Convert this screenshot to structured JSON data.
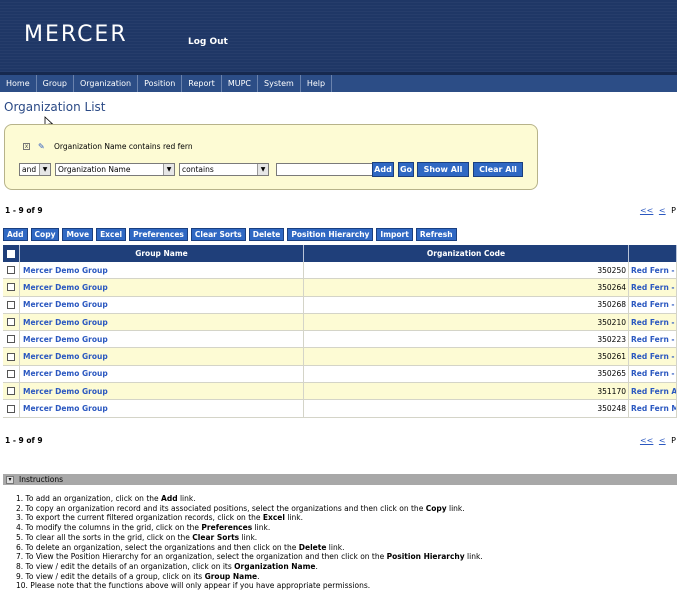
{
  "header": {
    "logo": "MERCER",
    "logout": "Log Out"
  },
  "nav": [
    "Home",
    "Group",
    "Organization",
    "Position",
    "Report",
    "MUPC",
    "System",
    "Help"
  ],
  "page_title": "Organization List",
  "filter": {
    "summary": "Organization Name contains red fern",
    "conjunction": "and",
    "field": "Organization Name",
    "operator": "contains",
    "value": "",
    "add_label": "Add",
    "go_label": "Go",
    "show_all_label": "Show All",
    "clear_all_label": "Clear All"
  },
  "count_text": "1 - 9 of 9",
  "pager": {
    "first": "<<",
    "prev": "<",
    "next_partial": "P"
  },
  "toolbar": [
    "Add",
    "Copy",
    "Move",
    "Excel",
    "Preferences",
    "Clear Sorts",
    "Delete",
    "Position Hierarchy",
    "Import",
    "Refresh"
  ],
  "grid": {
    "columns": {
      "group_name": "Group Name",
      "org_code": "Organization Code"
    },
    "rows": [
      {
        "group": "Mercer Demo Group",
        "code": "350250",
        "desc": "Red Fern -"
      },
      {
        "group": "Mercer Demo Group",
        "code": "350264",
        "desc": "Red Fern -"
      },
      {
        "group": "Mercer Demo Group",
        "code": "350268",
        "desc": "Red Fern - ,"
      },
      {
        "group": "Mercer Demo Group",
        "code": "350210",
        "desc": "Red Fern -"
      },
      {
        "group": "Mercer Demo Group",
        "code": "350223",
        "desc": "Red Fern -"
      },
      {
        "group": "Mercer Demo Group",
        "code": "350261",
        "desc": "Red Fern -"
      },
      {
        "group": "Mercer Demo Group",
        "code": "350265",
        "desc": "Red Fern -"
      },
      {
        "group": "Mercer Demo Group",
        "code": "351170",
        "desc": "Red Fern A"
      },
      {
        "group": "Mercer Demo Group",
        "code": "350248",
        "desc": "Red Fern M"
      }
    ]
  },
  "instructions": {
    "title": "Instructions",
    "items": [
      [
        "1. To add an organization, click on the ",
        "Add",
        " link."
      ],
      [
        "2. To copy an organization record and its associated positions, select the organizations and then click on the ",
        "Copy",
        " link."
      ],
      [
        "3. To export the current filtered organization records, click on the ",
        "Excel",
        " link."
      ],
      [
        "4. To modify the columns in the grid, click on the ",
        "Preferences",
        " link."
      ],
      [
        "5. To clear all the sorts in the grid, click on the ",
        "Clear Sorts",
        " link."
      ],
      [
        "6. To delete an organization, select the organizations and then click on the ",
        "Delete",
        " link."
      ],
      [
        "7. To View the Position Hierarchy for an organization, select the organization and then click on the ",
        "Position Hierarchy",
        " link."
      ],
      [
        "8. To view / edit the details of an organization, click on its ",
        "Organization Name",
        "."
      ],
      [
        "9. To view / edit the details of a group, click on its ",
        "Group Name",
        "."
      ],
      [
        "10. Please note that the functions above will only appear if you have appropriate permissions.",
        "",
        ""
      ]
    ]
  }
}
